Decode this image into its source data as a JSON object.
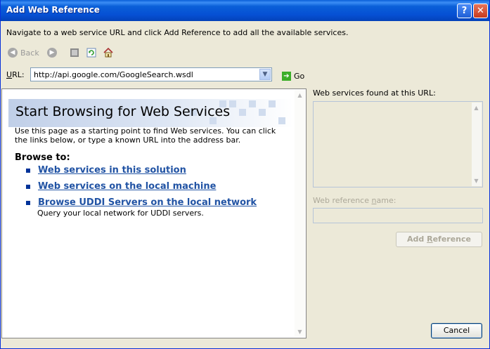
{
  "window": {
    "title": "Add Web Reference",
    "help_label": "?",
    "close_label": "✕"
  },
  "instructions": "Navigate to a web service URL and click Add Reference to add all the available services.",
  "toolbar": {
    "back_label": "Back",
    "back_icon": "back-arrow-icon",
    "forward_icon": "forward-arrow-icon",
    "stop_icon": "stop-icon",
    "refresh_icon": "refresh-icon",
    "home_icon": "home-icon"
  },
  "url": {
    "label": "URL:",
    "value": "http://api.google.com/GoogleSearch.wsdl",
    "go_label": "Go"
  },
  "browser": {
    "banner_title": "Start Browsing for Web Services",
    "description": "Use this page as a starting point to find Web services. You can click the links below, or type a known URL into the address bar.",
    "browse_to": "Browse to:",
    "links": [
      {
        "label": "Web services in this solution"
      },
      {
        "label": "Web services on the local machine"
      },
      {
        "label": "Browse UDDI Servers on the local network",
        "description": "Query your local network for UDDI servers."
      }
    ]
  },
  "results": {
    "found_label": "Web services found at this URL:",
    "ref_name_label": "Web reference name:",
    "ref_name_value": "",
    "add_reference_label": "Add Reference"
  },
  "cancel_label": "Cancel",
  "colors": {
    "titlebar": "#0a5fd8",
    "dialog_bg": "#ece9d8",
    "link": "#2153a4"
  }
}
